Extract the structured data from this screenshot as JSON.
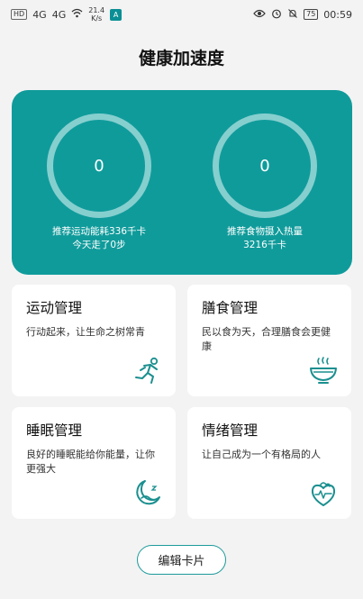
{
  "statusbar": {
    "network_chip": "HD",
    "signal1": "4G",
    "signal2": "4G",
    "speed_value": "21.4",
    "speed_unit": "K/s",
    "app_badge": "A",
    "battery": "75",
    "time": "00:59"
  },
  "page": {
    "title": "健康加速度"
  },
  "hero": {
    "left": {
      "value": "0",
      "line1": "推荐运动能耗336千卡",
      "line2": "今天走了0步"
    },
    "right": {
      "value": "0",
      "line1": "推荐食物摄入热量",
      "line2": "3216千卡"
    }
  },
  "cards": [
    {
      "title": "运动管理",
      "desc": "行动起来，让生命之树常青",
      "icon": "running-person-icon"
    },
    {
      "title": "膳食管理",
      "desc": "民以食为天，合理膳食会更健康",
      "icon": "food-bowl-icon"
    },
    {
      "title": "睡眠管理",
      "desc": "良好的睡眠能给你能量，让你更强大",
      "icon": "sleep-moon-icon"
    },
    {
      "title": "情绪管理",
      "desc": "让自己成为一个有格局的人",
      "icon": "heart-strawberry-icon"
    }
  ],
  "actions": {
    "edit_label": "编辑卡片"
  },
  "colors": {
    "accent": "#109b9b",
    "ring": "#86cfcf",
    "background": "#f3f3f3"
  }
}
